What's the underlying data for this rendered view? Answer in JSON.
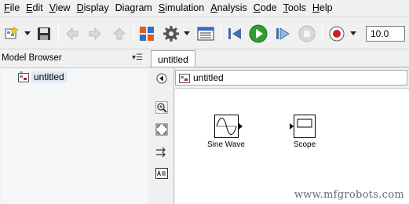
{
  "menu": {
    "items": [
      {
        "first": "F",
        "rest": "ile"
      },
      {
        "first": "E",
        "rest": "dit"
      },
      {
        "first": "V",
        "rest": "iew"
      },
      {
        "first": "D",
        "rest": "isplay"
      },
      {
        "first": "Diagram",
        "rest": ""
      },
      {
        "first": "S",
        "rest": "imulation"
      },
      {
        "first": "A",
        "rest": "nalysis"
      },
      {
        "first": "C",
        "rest": "ode"
      },
      {
        "first": "T",
        "rest": "ools"
      },
      {
        "first": "H",
        "rest": "elp"
      }
    ]
  },
  "toolbar": {
    "stop_time": "10.0"
  },
  "browser": {
    "title": "Model Browser",
    "menu_glyph": "▾☰",
    "tree": [
      {
        "label": "untitled"
      }
    ]
  },
  "tabs": [
    {
      "label": "untitled"
    }
  ],
  "address": {
    "label": "untitled"
  },
  "canvas": {
    "blocks": [
      {
        "label": "Sine Wave"
      },
      {
        "label": "Scope"
      }
    ],
    "watermark": "www.mfgrobots.com"
  },
  "colors": {
    "run_green": "#2e9e2e",
    "record_red": "#cc1f1f",
    "icon_blue": "#6a8fc4"
  }
}
